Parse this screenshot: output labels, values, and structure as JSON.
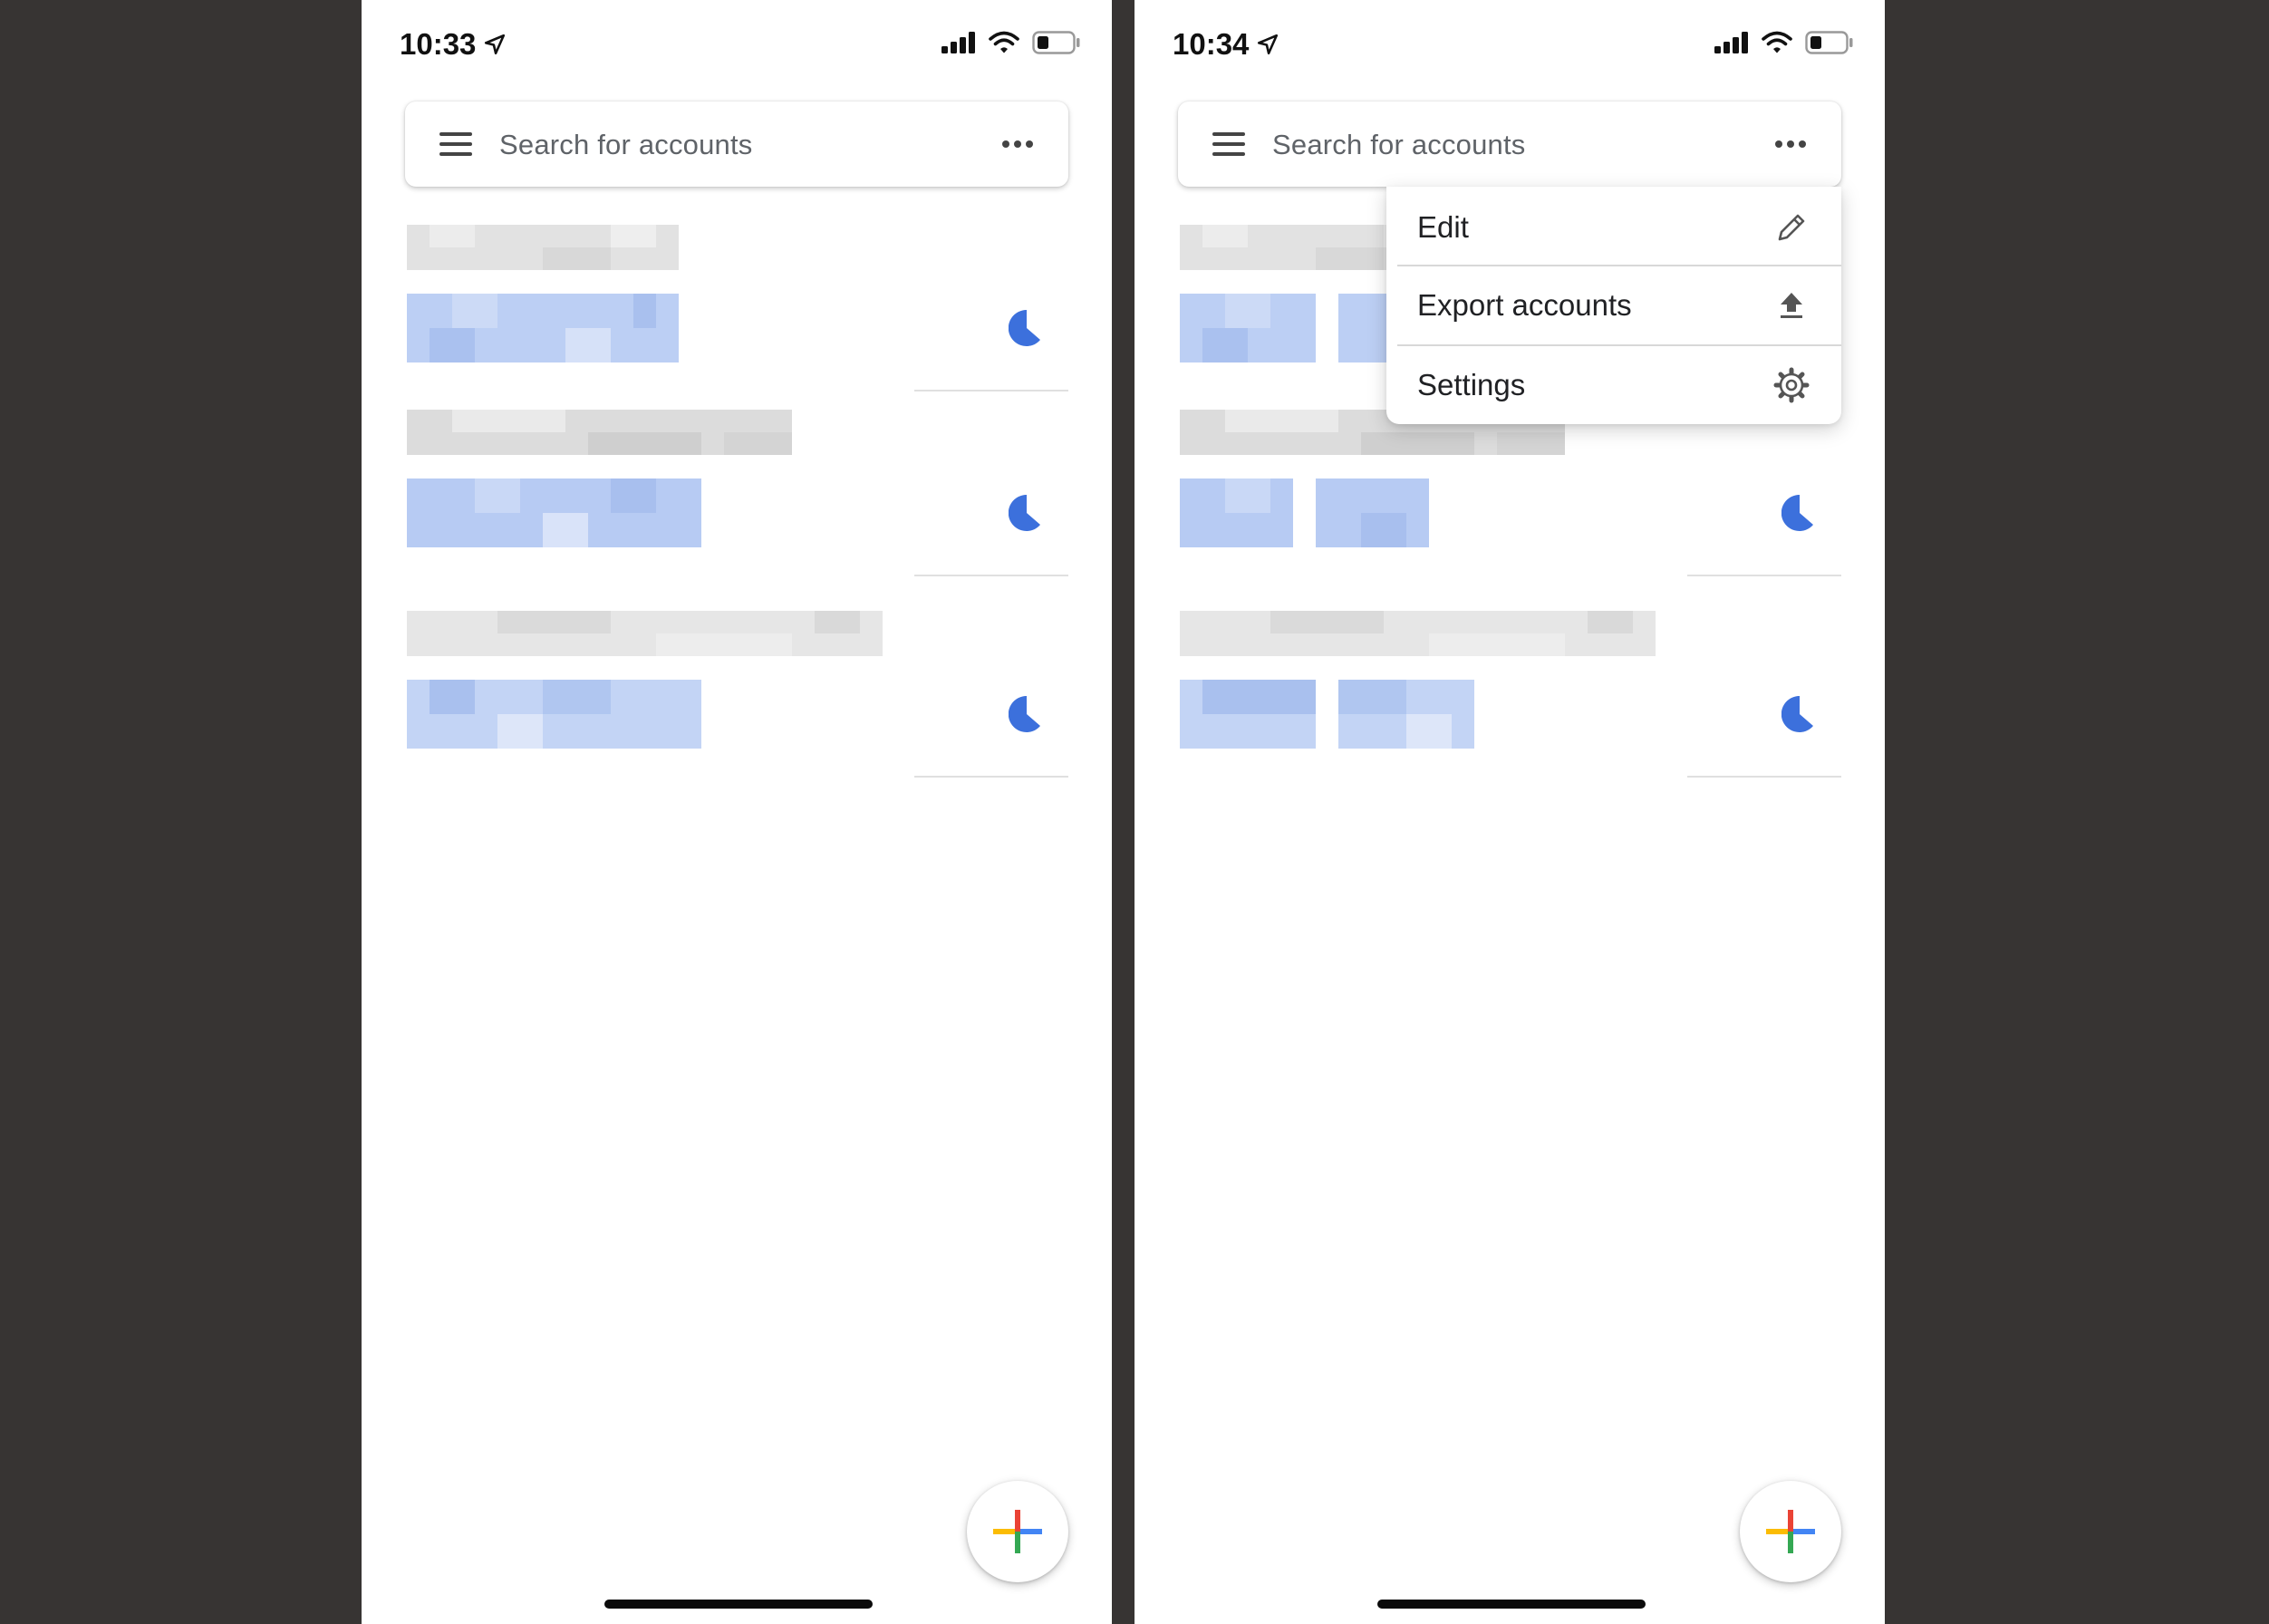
{
  "screens": [
    {
      "status_time": "10:33",
      "search_placeholder": "Search for accounts"
    },
    {
      "status_time": "10:34",
      "search_placeholder": "Search for accounts"
    }
  ],
  "menu": {
    "items": [
      {
        "label": "Edit",
        "icon": "pencil-icon"
      },
      {
        "label": "Export accounts",
        "icon": "upload-icon"
      },
      {
        "label": "Settings",
        "icon": "gear-icon"
      }
    ]
  },
  "colors": {
    "background": "#373433",
    "accent_blue": "#3c70dc",
    "google_red": "#ea4335",
    "google_blue": "#4285f4",
    "google_yellow": "#fbbc04",
    "google_green": "#34a853"
  }
}
